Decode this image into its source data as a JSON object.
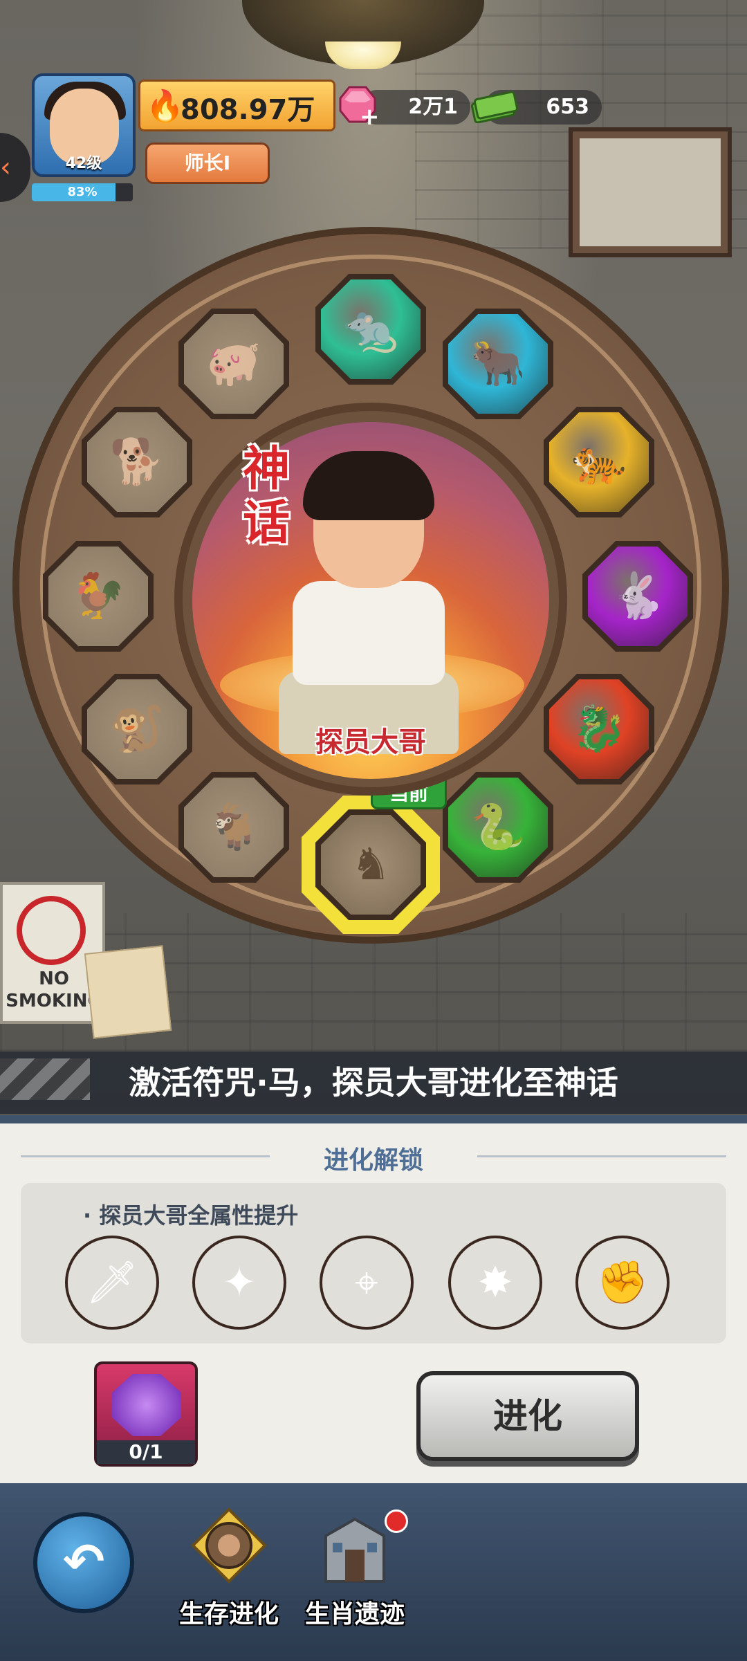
{
  "hud": {
    "level": "42级",
    "xp_percent": "83%",
    "xp_fraction": 0.83,
    "power": "808.97万",
    "rank": "师长I",
    "gems": "2万1",
    "cash": "653"
  },
  "wheel": {
    "myth_label": "神话",
    "hero_name": "探员大哥",
    "current_tag": "当前",
    "signs": [
      {
        "name": "rat",
        "lit": true,
        "color": "#2fbf95"
      },
      {
        "name": "ox",
        "lit": true,
        "color": "#2fb6d6"
      },
      {
        "name": "tiger",
        "lit": true,
        "color": "#e6b22a"
      },
      {
        "name": "rabbit",
        "lit": true,
        "color": "#a524c9"
      },
      {
        "name": "dragon",
        "lit": true,
        "color": "#e04225"
      },
      {
        "name": "snake",
        "lit": true,
        "color": "#37b339"
      },
      {
        "name": "horse",
        "lit": false,
        "color": "#8a7a64"
      },
      {
        "name": "goat",
        "lit": false,
        "color": "#8a7a64"
      },
      {
        "name": "monkey",
        "lit": false,
        "color": "#8a7a64"
      },
      {
        "name": "rooster",
        "lit": false,
        "color": "#8a7a64"
      },
      {
        "name": "dog",
        "lit": false,
        "color": "#8a7a64"
      },
      {
        "name": "pig",
        "lit": false,
        "color": "#8a7a64"
      }
    ]
  },
  "sign_board": {
    "text": "NO SMOKING"
  },
  "banner": {
    "text": "激活符咒·马，探员大哥进化至神话"
  },
  "unlock": {
    "title": "进化解锁",
    "subtitle": "· 探员大哥全属性提升",
    "skills": [
      {
        "icon": "sword-icon",
        "color": "#d9542a"
      },
      {
        "icon": "gunner-icon",
        "color": "#6b4a2a"
      },
      {
        "icon": "crosshair-icon",
        "color": "#2f8a2f"
      },
      {
        "icon": "rifle-icon",
        "color": "#b8421f"
      },
      {
        "icon": "martial-arts-icon",
        "color": "#c9521f"
      }
    ]
  },
  "item": {
    "count": "0/1"
  },
  "evolve_button": {
    "label": "进化"
  },
  "nav": {
    "tab1": "生存进化",
    "tab2": "生肖遗迹"
  }
}
